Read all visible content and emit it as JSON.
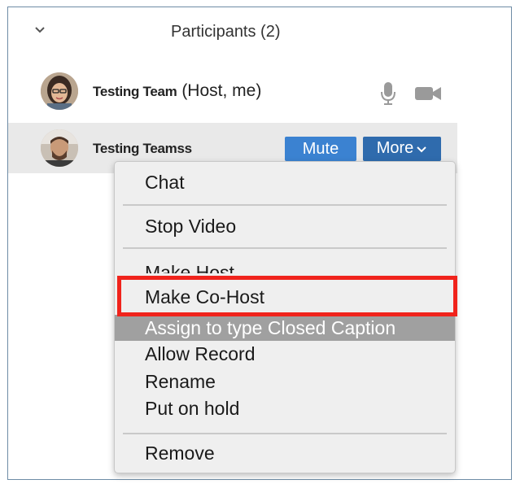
{
  "header": {
    "title": "Participants (2)",
    "collapse_icon": "chevron-down-icon"
  },
  "participants": [
    {
      "name_overlay": "Testing Team",
      "role": "(Host, me)",
      "mic_icon": "microphone-icon",
      "video_icon": "video-camera-icon"
    },
    {
      "name_overlay": "Testing Teamss",
      "mute_label": "Mute",
      "more_label": "More"
    }
  ],
  "menu": {
    "items": [
      "Chat",
      "Stop Video",
      "Make Host",
      "Make Co-Host",
      "Assign to type Closed Caption",
      "Allow Record",
      "Rename",
      "Put on hold",
      "Remove"
    ]
  },
  "colors": {
    "mute_button": "#3b82d1",
    "more_button": "#2f6bad",
    "highlight_box": "#f0231c",
    "selected_row": "#a0a0a0"
  }
}
